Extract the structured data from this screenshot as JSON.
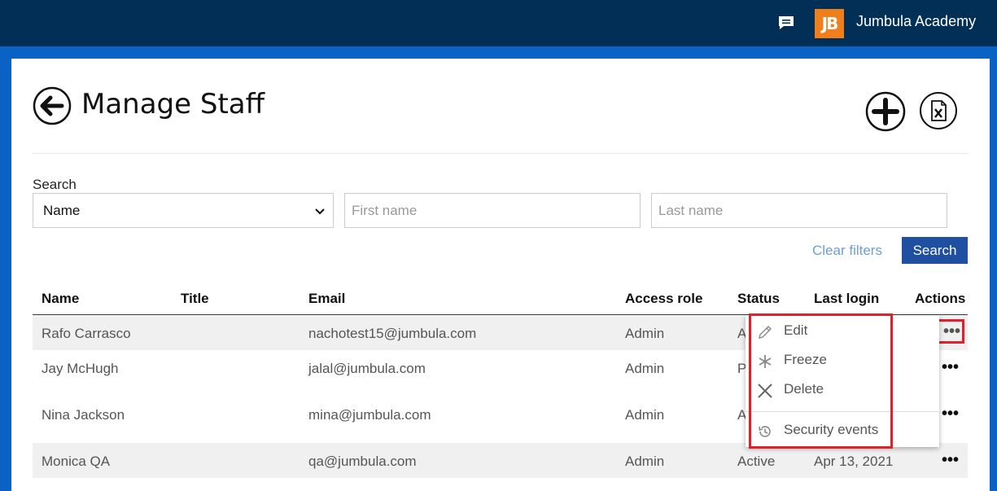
{
  "header": {
    "org_name": "Jumbula Academy",
    "logo_text": "JB"
  },
  "page": {
    "title": "Manage Staff"
  },
  "search": {
    "label": "Search",
    "select_value": "Name",
    "first_name_placeholder": "First name",
    "last_name_placeholder": "Last name",
    "clear_label": "Clear filters",
    "button_label": "Search"
  },
  "table": {
    "headers": {
      "name": "Name",
      "title": "Title",
      "email": "Email",
      "access_role": "Access role",
      "status": "Status",
      "last_login": "Last login",
      "actions": "Actions"
    },
    "rows": [
      {
        "name": "Rafo Carrasco",
        "email": "nachotest15@jumbula.com",
        "access_role": "Admin",
        "status": "A",
        "last_login": ""
      },
      {
        "name": "Jay McHugh",
        "email": "jalal@jumbula.com",
        "access_role": "Admin",
        "status": "P",
        "last_login": ""
      },
      {
        "name": "Nina Jackson",
        "email": "mina@jumbula.com",
        "access_role": "Admin",
        "status": "A",
        "last_login": ""
      },
      {
        "name": "Monica QA",
        "email": "qa@jumbula.com",
        "access_role": "Admin",
        "status": "Active",
        "last_login": "Apr 13, 2021"
      }
    ],
    "actions_glyph": "•••"
  },
  "menu": {
    "items": [
      {
        "label": "Edit",
        "icon": "pencil-icon"
      },
      {
        "label": "Freeze",
        "icon": "snowflake-icon"
      },
      {
        "label": "Delete",
        "icon": "x-icon"
      },
      {
        "label": "Security events",
        "icon": "history-icon"
      }
    ]
  },
  "colors": {
    "topbar": "#022f55",
    "frame": "#0a62c4",
    "accent": "#1e4fa0",
    "logo": "#f07f1b",
    "highlight": "#e0202a"
  }
}
